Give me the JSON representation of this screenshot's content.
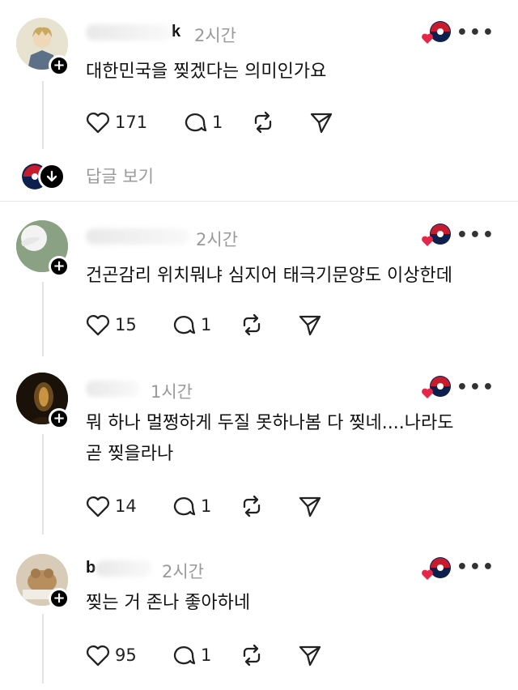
{
  "colors": {
    "heart": "#e8264a",
    "text": "#111111",
    "muted": "#9a9a9a",
    "divider": "#e6e6e6"
  },
  "posts": [
    {
      "username": "k",
      "time": "2시간",
      "text": "대한민국을 찢겠다는 의미인가요",
      "likes": "171",
      "comments": "1"
    },
    {
      "username": "",
      "time": "2시간",
      "text": "건곤감리 위치뭐냐 심지어 태극기문양도 이상한데",
      "likes": "15",
      "comments": "1"
    },
    {
      "username": "",
      "time": "1시간",
      "text": "뭐 하나 멀쩡하게 두질 못하나봄 다 찢네....나라도\n곧 찢을라나",
      "likes": "14",
      "comments": "1"
    },
    {
      "username": "b",
      "time": "2시간",
      "text": "찢는 거 존나 좋아하네",
      "likes": "95",
      "comments": "1"
    }
  ],
  "replies_label": "답글 보기",
  "icons": [
    "heart-icon",
    "comment-icon",
    "repost-icon",
    "share-icon",
    "more-icon",
    "follow-plus-icon",
    "expand-down-icon"
  ]
}
